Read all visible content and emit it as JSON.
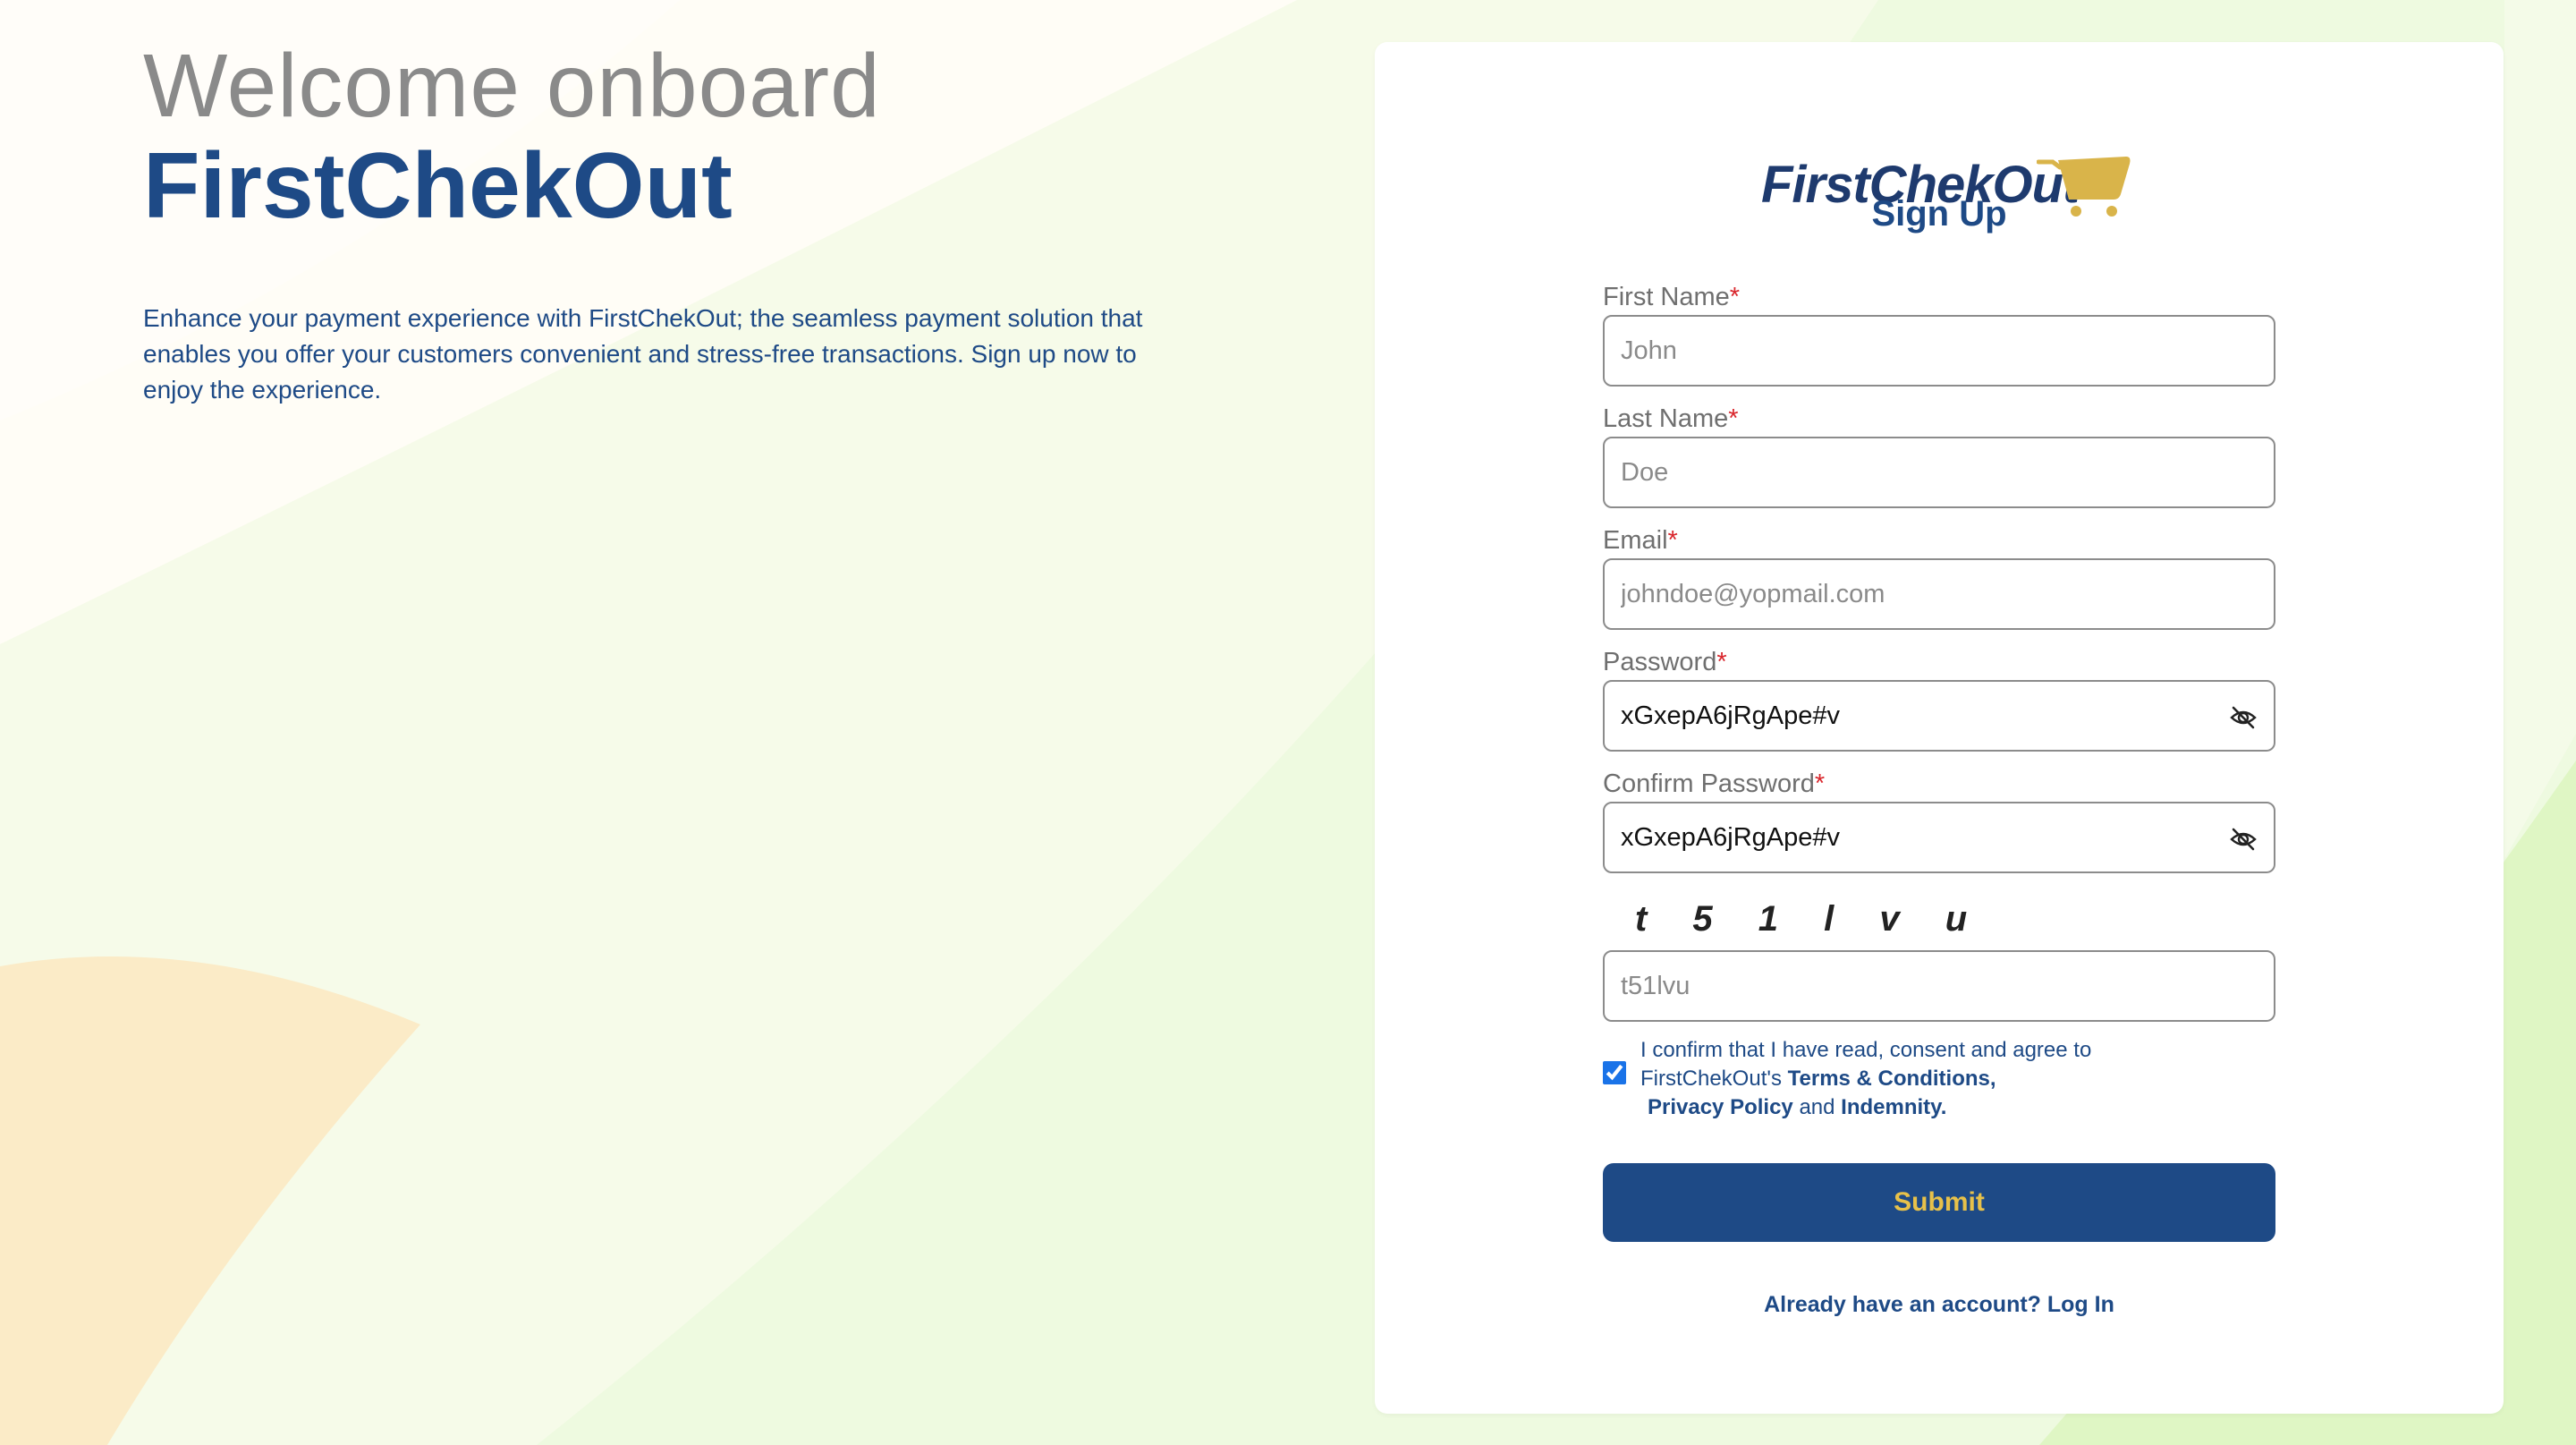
{
  "colors": {
    "brand_blue": "#1e4a86",
    "accent_gold": "#e7c14a",
    "required_red": "#d9262c",
    "bg_green": "#e6f8d0",
    "bg_cream": "#fdf7e6",
    "bg_peach": "#fbeac6"
  },
  "hero": {
    "line1": "Welcome onboard",
    "line2": "FirstChekOut",
    "description": "Enhance your payment experience with FirstChekOut; the seamless payment solution that enables you offer your customers convenient and stress-free transactions. Sign up now to enjoy the experience."
  },
  "card": {
    "logo_text": "FirstChekOut",
    "logo_icon": "shopping-cart-icon",
    "title": "Sign Up"
  },
  "form": {
    "required_marker": "*",
    "first_name": {
      "label": "First Name",
      "placeholder": "John",
      "value": ""
    },
    "last_name": {
      "label": "Last Name",
      "placeholder": "Doe",
      "value": ""
    },
    "email": {
      "label": "Email",
      "placeholder": "johndoe@yopmail.com",
      "value": ""
    },
    "password": {
      "label": "Password",
      "value": "xGxepA6jRgApe#v",
      "toggle_icon": "eye-slash-icon"
    },
    "confirm_password": {
      "label": "Confirm Password",
      "value": "xGxepA6jRgApe#v",
      "toggle_icon": "eye-slash-icon"
    },
    "captcha": {
      "image_text": "t 5 1 l v u",
      "placeholder": "t51lvu",
      "value": ""
    },
    "consent": {
      "checked": true,
      "text_1": "I confirm that I have read, consent and agree to",
      "text_2": "FirstChekOut's",
      "terms_link": "Terms & Conditions,",
      "privacy_link": "Privacy Policy",
      "and_word": "and",
      "indemnity_link": "Indemnity."
    },
    "submit_label": "Submit",
    "login_prompt": "Already have an account?",
    "login_link": "Log In"
  }
}
